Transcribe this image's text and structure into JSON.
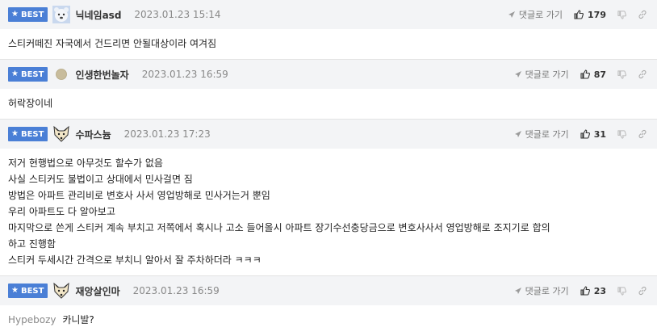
{
  "badge_label": "BEST",
  "reply_label": "댓글로 가기",
  "comments": [
    {
      "nickname": "닉네임asd",
      "date": "2023.01.23 15:14",
      "likes": "179",
      "avatar_icon": "polar-bear-avatar-icon",
      "lines": [
        "스티커떼진 자국에서 건드리면 안될대상이라 여겨짐"
      ]
    },
    {
      "nickname": "인생한번놀자",
      "date": "2023.01.23 16:59",
      "likes": "87",
      "avatar_icon": "default-dot-avatar-icon",
      "lines": [
        "허락장이네"
      ]
    },
    {
      "nickname": "수파스늄",
      "date": "2023.01.23 17:23",
      "likes": "31",
      "avatar_icon": "fox-avatar-icon",
      "lines": [
        "저거 현행법으로 아무것도 할수가 없음",
        "사실 스티커도 불법이고 상대에서 민사걸면 짐",
        "방법은 아파트 관리비로 변호사 사서 영업방해로 민사거는거 뿐임",
        "우리 아파트도 다 알아보고",
        "마지막으로 쓴게 스티커 계속 부치고 저쪽에서 혹시나 고소 들어올시 아파트 장기수선충당금으로 변호사사서 영업방해로 조지기로 합의",
        "하고 진행함",
        "스티커 두세시간 간격으로 부치니 알아서 잘 주차하더라 ㅋㅋㅋ"
      ]
    },
    {
      "nickname": "재앙살인마",
      "date": "2023.01.23 16:59",
      "likes": "23",
      "avatar_icon": "fox-avatar-icon",
      "reply_to": "Hypebozy",
      "lines": [
        "카니발?"
      ]
    }
  ],
  "colors": {
    "badge": "#4a7fd6",
    "header_bg": "#f3f4f6",
    "date": "#888888"
  }
}
